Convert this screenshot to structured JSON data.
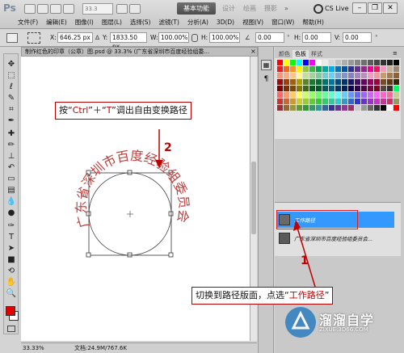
{
  "app": {
    "logo": "Ps",
    "zoom": "33.3",
    "workspace_active": "基本功能",
    "workspaces": [
      "设计",
      "绘画",
      "摄影"
    ],
    "cs_live": "CS Live"
  },
  "menus": [
    "文件(F)",
    "编辑(E)",
    "图像(I)",
    "图层(L)",
    "选择(S)",
    "滤镜(T)",
    "分析(A)",
    "3D(D)",
    "视图(V)",
    "窗口(W)",
    "帮助(H)"
  ],
  "options": {
    "x_label": "X:",
    "x_value": "646.25 px",
    "y_label": "Y:",
    "y_value": "1833.50 px",
    "w_label": "W:",
    "w_value": "100.00%",
    "h_label": "H:",
    "h_value": "100.00%",
    "angle_value": "0.00",
    "h_skew_label": "H:",
    "h_skew_value": "0.00",
    "v_skew_label": "V:",
    "v_skew_value": "0.00"
  },
  "document": {
    "tab_title": "制作红色的印章（公章）图.psd @ 33.3% (广东省深圳市百度经验组委...",
    "stamp_text": "广东省深圳市百度经验组委员会"
  },
  "status": {
    "zoom": "33.33%",
    "doc_size": "文档:24.9M/767.6K"
  },
  "panels": {
    "top_tabs": [
      "颜色",
      "色板",
      "样式"
    ],
    "top_active": 1,
    "bottom_tabs": [
      "图层",
      "通道",
      "路径"
    ],
    "bottom_active": 2,
    "paths": [
      {
        "name": "工作路径",
        "selected": true
      },
      {
        "name": "广东省深圳市百度经验组委员会...",
        "selected": false
      }
    ]
  },
  "annotations": {
    "step2_prefix": "按“",
    "step2_key1": "Ctrl",
    "step2_mid": "”＋“",
    "step2_key2": "T",
    "step2_suffix": "”调出自由变换路径",
    "step2_num": "2",
    "step1_prefix": "切换到路径版面，点选“",
    "step1_target": "工作路径",
    "step1_suffix": "”",
    "step1_num": "1"
  },
  "watermark": {
    "title": "溜溜自学",
    "subtitle": "ZIXUE.3D66.COM"
  },
  "colors": {
    "foreground": "#e00000",
    "background": "#ffffff",
    "selected_row": "#3399ff",
    "annotation_red": "#c00000",
    "stamp_red": "#c04040"
  },
  "swatches": [
    "#ff0000",
    "#ffff00",
    "#00ff00",
    "#00ffff",
    "#0000ff",
    "#ff00ff",
    "#ffffff",
    "#ebebeb",
    "#d6d6d6",
    "#c2c2c2",
    "#adadad",
    "#999999",
    "#858585",
    "#707070",
    "#5c5c5c",
    "#474747",
    "#333333",
    "#1f1f1f",
    "#000000",
    "#ee1d24",
    "#f26522",
    "#f7941d",
    "#fff200",
    "#8dc63f",
    "#39b54a",
    "#00a651",
    "#00a99d",
    "#00aeef",
    "#0072bc",
    "#0054a6",
    "#2e3192",
    "#662d91",
    "#92278f",
    "#ec008c",
    "#ed145b",
    "#f49ac1",
    "#c7b299",
    "#998675",
    "#f7977a",
    "#f9ad81",
    "#fdc68a",
    "#fff79a",
    "#c4df9b",
    "#a3d39c",
    "#82ca9d",
    "#7accc8",
    "#6dcff6",
    "#7da7d9",
    "#8393ca",
    "#8781bd",
    "#a187be",
    "#bc8dbf",
    "#f49ac1",
    "#f5989d",
    "#c69c6d",
    "#a67c52",
    "#8c6239",
    "#9e0b0f",
    "#a0410d",
    "#a3620a",
    "#aba000",
    "#598527",
    "#1a7b30",
    "#007236",
    "#00746b",
    "#0076a3",
    "#004b80",
    "#003471",
    "#1b1464",
    "#440e62",
    "#630460",
    "#9e005d",
    "#9e0039",
    "#754c24",
    "#603913",
    "#3c2415",
    "#790000",
    "#7b2e00",
    "#7d4900",
    "#827b00",
    "#406618",
    "#005e20",
    "#005826",
    "#005952",
    "#005b7f",
    "#003663",
    "#002157",
    "#0d004c",
    "#32004b",
    "#4b0049",
    "#7b0046",
    "#7a0026",
    "#534741",
    "#362f2d",
    "#00ff66",
    "#ff6666",
    "#ff9966",
    "#ffcc66",
    "#ffff66",
    "#ccff66",
    "#99ff66",
    "#66ff66",
    "#66ff99",
    "#66ffcc",
    "#66ffff",
    "#66ccff",
    "#6699ff",
    "#6666ff",
    "#9966ff",
    "#cc66ff",
    "#ff66ff",
    "#ff66cc",
    "#ff6699",
    "#cccc99",
    "#cc3333",
    "#cc6633",
    "#cc9933",
    "#cccc33",
    "#99cc33",
    "#66cc33",
    "#33cc33",
    "#33cc66",
    "#33cc99",
    "#33cccc",
    "#3399cc",
    "#3366cc",
    "#3333cc",
    "#6633cc",
    "#9933cc",
    "#cc33cc",
    "#cc3399",
    "#cc3366",
    "#999966",
    "#993333",
    "#996633",
    "#999933",
    "#669933",
    "#339933",
    "#339966",
    "#339999",
    "#336699",
    "#333399",
    "#663399",
    "#993399",
    "#993366",
    "#cccccc",
    "#999999",
    "#666666",
    "#333333",
    "#000000",
    "#ffffff",
    "#ff0000"
  ]
}
